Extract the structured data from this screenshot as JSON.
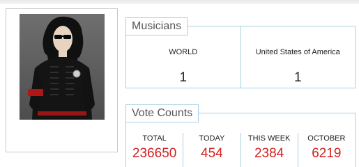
{
  "musicians": {
    "title": "Musicians",
    "items": [
      {
        "label": "WORLD",
        "value": "1"
      },
      {
        "label": "United States of America",
        "value": "1"
      }
    ]
  },
  "votes": {
    "title": "Vote Counts",
    "items": [
      {
        "label": "TOTAL",
        "value": "236650"
      },
      {
        "label": "TODAY",
        "value": "454"
      },
      {
        "label": "THIS WEEK",
        "value": "2384"
      },
      {
        "label": "OCTOBER",
        "value": "6219"
      }
    ],
    "value_color": "#d42020"
  }
}
